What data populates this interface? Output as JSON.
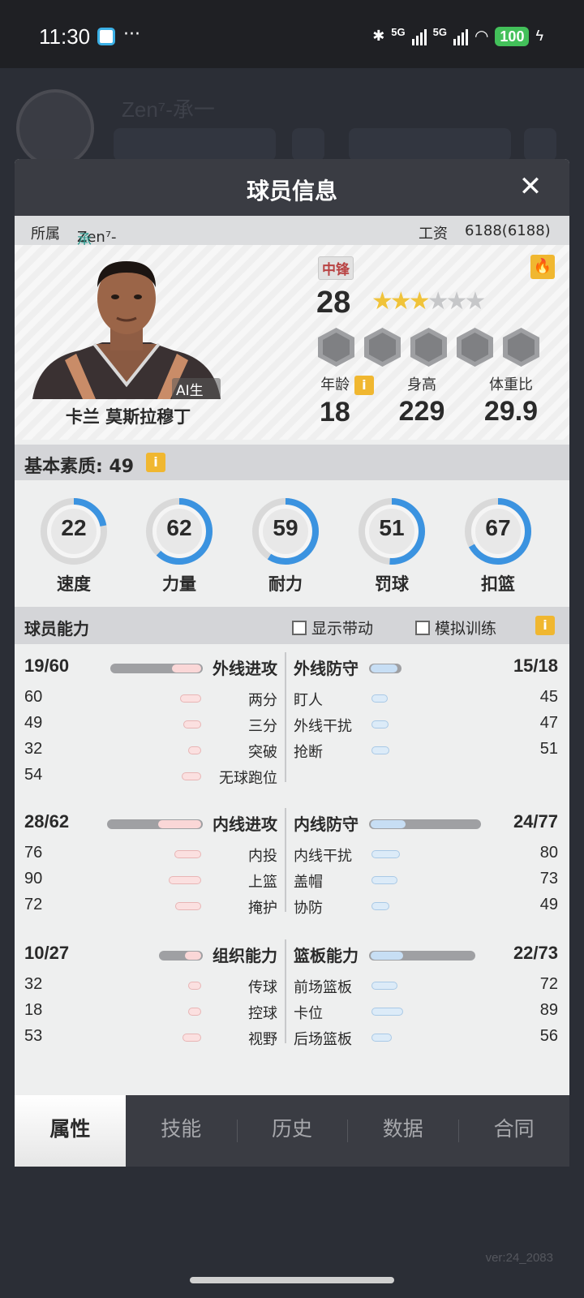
{
  "status_bar": {
    "time": "11:30",
    "dots": "···",
    "net1": "5G",
    "net2": "5G",
    "battery": "100"
  },
  "background": {
    "version": "ver:24_2083",
    "team_name": "Zen⁷-承一"
  },
  "modal": {
    "title": "球员信息",
    "close": "✕",
    "affiliation_label": "所属",
    "team_prefix": "Zen⁷-",
    "team_suffix": "承一",
    "salary_label": "工资",
    "salary_value": "6188(6188)"
  },
  "player": {
    "ai_tag": "AI生成",
    "name": "卡兰 莫斯拉穆丁",
    "position": "中锋",
    "overall": "28",
    "stars_filled": 3,
    "stars_total": 6,
    "age_label": "年龄",
    "age": "18",
    "height_label": "身高",
    "height": "229",
    "weight_label": "体重比",
    "weight": "29.9",
    "info_icon": "i",
    "fire_icon": "🔥"
  },
  "basics": {
    "label": "基本素质: 49",
    "items": [
      {
        "label": "速度",
        "value": 22,
        "percent": 22
      },
      {
        "label": "力量",
        "value": 62,
        "percent": 62
      },
      {
        "label": "耐力",
        "value": 59,
        "percent": 59
      },
      {
        "label": "罚球",
        "value": 51,
        "percent": 51
      },
      {
        "label": "扣篮",
        "value": 67,
        "percent": 67
      }
    ]
  },
  "ability": {
    "label": "球员能力",
    "show_drive": "显示带动",
    "sim_training": "模拟训练",
    "sections": [
      {
        "left": {
          "title": "外线进攻",
          "score": "19/60",
          "current": 19,
          "max": 60
        },
        "right": {
          "title": "外线防守",
          "score": "15/18",
          "current": 15,
          "max": 18
        },
        "rows": [
          {
            "lv": "60",
            "ll": "两分",
            "rl": "盯人",
            "rv": "45"
          },
          {
            "lv": "49",
            "ll": "三分",
            "rl": "外线干扰",
            "rv": "47"
          },
          {
            "lv": "32",
            "ll": "突破",
            "rl": "抢断",
            "rv": "51"
          },
          {
            "lv": "54",
            "ll": "无球跑位",
            "rl": "",
            "rv": ""
          }
        ]
      },
      {
        "left": {
          "title": "内线进攻",
          "score": "28/62",
          "current": 28,
          "max": 62
        },
        "right": {
          "title": "内线防守",
          "score": "24/77",
          "current": 24,
          "max": 77
        },
        "rows": [
          {
            "lv": "76",
            "ll": "内投",
            "rl": "内线干扰",
            "rv": "80"
          },
          {
            "lv": "90",
            "ll": "上篮",
            "rl": "盖帽",
            "rv": "73"
          },
          {
            "lv": "72",
            "ll": "掩护",
            "rl": "协防",
            "rv": "49"
          }
        ]
      },
      {
        "left": {
          "title": "组织能力",
          "score": "10/27",
          "current": 10,
          "max": 27
        },
        "right": {
          "title": "篮板能力",
          "score": "22/73",
          "current": 22,
          "max": 73
        },
        "rows": [
          {
            "lv": "32",
            "ll": "传球",
            "rl": "前场篮板",
            "rv": "72"
          },
          {
            "lv": "18",
            "ll": "控球",
            "rl": "卡位",
            "rv": "89"
          },
          {
            "lv": "53",
            "ll": "视野",
            "rl": "后场篮板",
            "rv": "56"
          }
        ]
      }
    ]
  },
  "tabs": [
    {
      "label": "属性",
      "active": true
    },
    {
      "label": "技能",
      "active": false
    },
    {
      "label": "历史",
      "active": false
    },
    {
      "label": "数据",
      "active": false
    },
    {
      "label": "合同",
      "active": false
    }
  ],
  "colors": {
    "gauge_fill": "#3b93e0",
    "gauge_track": "#d9d9d9",
    "accent_gold": "#f0b730",
    "team_green": "#2f9a8e"
  }
}
